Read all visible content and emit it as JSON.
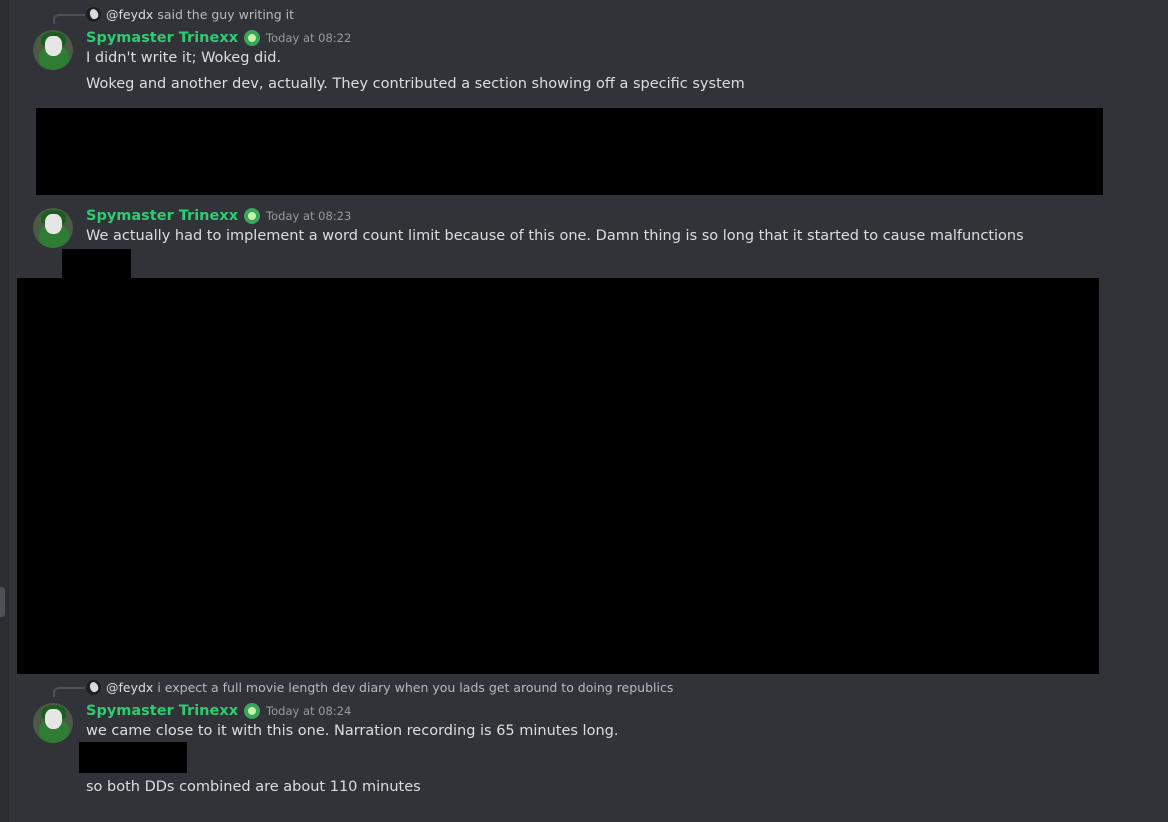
{
  "messages": [
    {
      "reply": {
        "user": "@feydx",
        "text": "said the guy writing it"
      },
      "author": "Spymaster Trinexx",
      "timestamp": "Today at 08:22",
      "lines": [
        "I didn't write it; Wokeg did.",
        "Wokeg and another dev, actually. They contributed a section showing off a specific system"
      ]
    },
    {
      "author": "Spymaster Trinexx",
      "timestamp": "Today at 08:23",
      "lines": [
        "We actually had to implement a word count limit because of this one. Damn thing is so long that it started to cause malfunctions"
      ]
    },
    {
      "reply": {
        "user": "@feydx",
        "text": "i expect a full movie length dev diary when you lads get around to doing republics"
      },
      "author": "Spymaster Trinexx",
      "timestamp": "Today at 08:24",
      "lines": [
        "we came close to it with this one. Narration recording is 65 minutes long.",
        "so both DDs combined are about 110 minutes"
      ]
    }
  ]
}
